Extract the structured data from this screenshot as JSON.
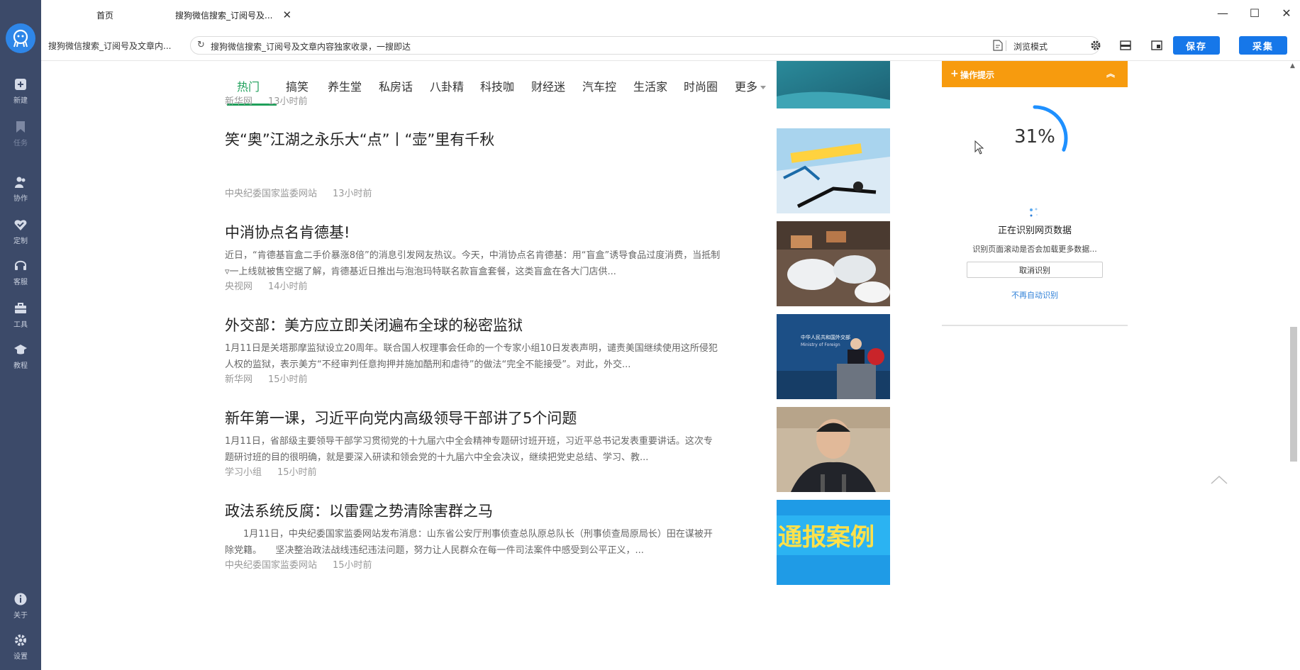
{
  "sidebar": {
    "items": [
      {
        "label": "新建",
        "icon": "plus-square-icon"
      },
      {
        "label": "任务",
        "icon": "bookmark-icon"
      },
      {
        "label": "协作",
        "icon": "people-icon"
      },
      {
        "label": "定制",
        "icon": "heart-check-icon"
      },
      {
        "label": "客服",
        "icon": "headset-icon"
      },
      {
        "label": "工具",
        "icon": "toolbox-icon"
      },
      {
        "label": "教程",
        "icon": "graduation-cap-icon"
      },
      {
        "label": "关于",
        "icon": "info-icon"
      },
      {
        "label": "设置",
        "icon": "gear-icon"
      }
    ]
  },
  "tabs": [
    {
      "label": "首页"
    },
    {
      "label": "搜狗微信搜索_订阅号及..."
    }
  ],
  "window": {
    "minimize": "—",
    "maximize": "☐",
    "close": "✕"
  },
  "addressbar": {
    "page_title": "搜狗微信搜索_订阅号及文章内...",
    "url": "搜狗微信搜索_订阅号及文章内容独家收录，一搜即达",
    "mode": "浏览模式",
    "save_label": "保存",
    "collect_label": "采集"
  },
  "channels": [
    "热门",
    "搞笑",
    "养生堂",
    "私房话",
    "八卦精",
    "科技咖",
    "财经迷",
    "汽车控",
    "生活家",
    "时尚圈",
    "更多"
  ],
  "news": [
    {
      "title": "",
      "summary": "",
      "source": "新华网",
      "time": "13小时前"
    },
    {
      "title": "笑“奥”江湖之永乐大“点”丨“壶”里有千秋",
      "summary": "",
      "source": "中央纪委国家监委网站",
      "time": "13小时前"
    },
    {
      "title": "中消协点名肯德基!",
      "summary": "近日，“肯德基盲盒二手价暴涨8倍”的消息引发网友热议。今天，中消协点名肯德基：用“盲盒”诱导食品过度消费，当抵制▿一上线就被售空据了解，肯德基近日推出与泡泡玛特联名款盲盒套餐，这类盲盒在各大门店供...",
      "source": "央视网",
      "time": "14小时前"
    },
    {
      "title": "外交部：美方应立即关闭遍布全球的秘密监狱",
      "summary": "1月11日是关塔那摩监狱设立20周年。联合国人权理事会任命的一个专家小组10日发表声明，谴责美国继续使用这所侵犯人权的监狱，表示美方“不经审判任意拘押并施加酷刑和虐待”的做法“完全不能接受”。对此，外交...",
      "source": "新华网",
      "time": "15小时前"
    },
    {
      "title": "新年第一课，习近平向党内高级领导干部讲了5个问题",
      "summary": "1月11日，省部级主要领导干部学习贯彻党的十九届六中全会精神专题研讨班开班，习近平总书记发表重要讲话。这次专题研讨班的目的很明确，就是要深入研读和领会党的十九届六中全会决议，继续把党史总结、学习、教...",
      "source": "学习小组",
      "time": "15小时前"
    },
    {
      "title": "政法系统反腐：以雷霆之势清除害群之马",
      "summary": "　　1月11日，中央纪委国家监委网站发布消息：山东省公安厅刑事侦查总队原总队长（刑事侦查局原局长）田在谋被开除党籍。　　坚决整治政法战线违纪违法问题，努力让人民群众在每一件司法案件中感受到公平正义，...",
      "source": "中央纪委国家监委网站",
      "time": "15小时前"
    }
  ],
  "thumb_texts": {
    "banner": "通报案例",
    "podium": "中华人民共和国外交部",
    "podium_en": "Ministry of Foreign"
  },
  "panel": {
    "title": "操作提示",
    "progress": 31,
    "progress_text": "31%",
    "status": "正在识别网页数据",
    "sub": "识别页面滚动是否会加载更多数据...",
    "cancel": "取消识别",
    "no_auto": "不再自动识别"
  },
  "colors": {
    "sidebar": "#3c4a69",
    "accent_blue": "#1677e9",
    "channel_active": "#1fa05b",
    "panel_head": "#f79b0e",
    "progress": "#1e90ff"
  }
}
